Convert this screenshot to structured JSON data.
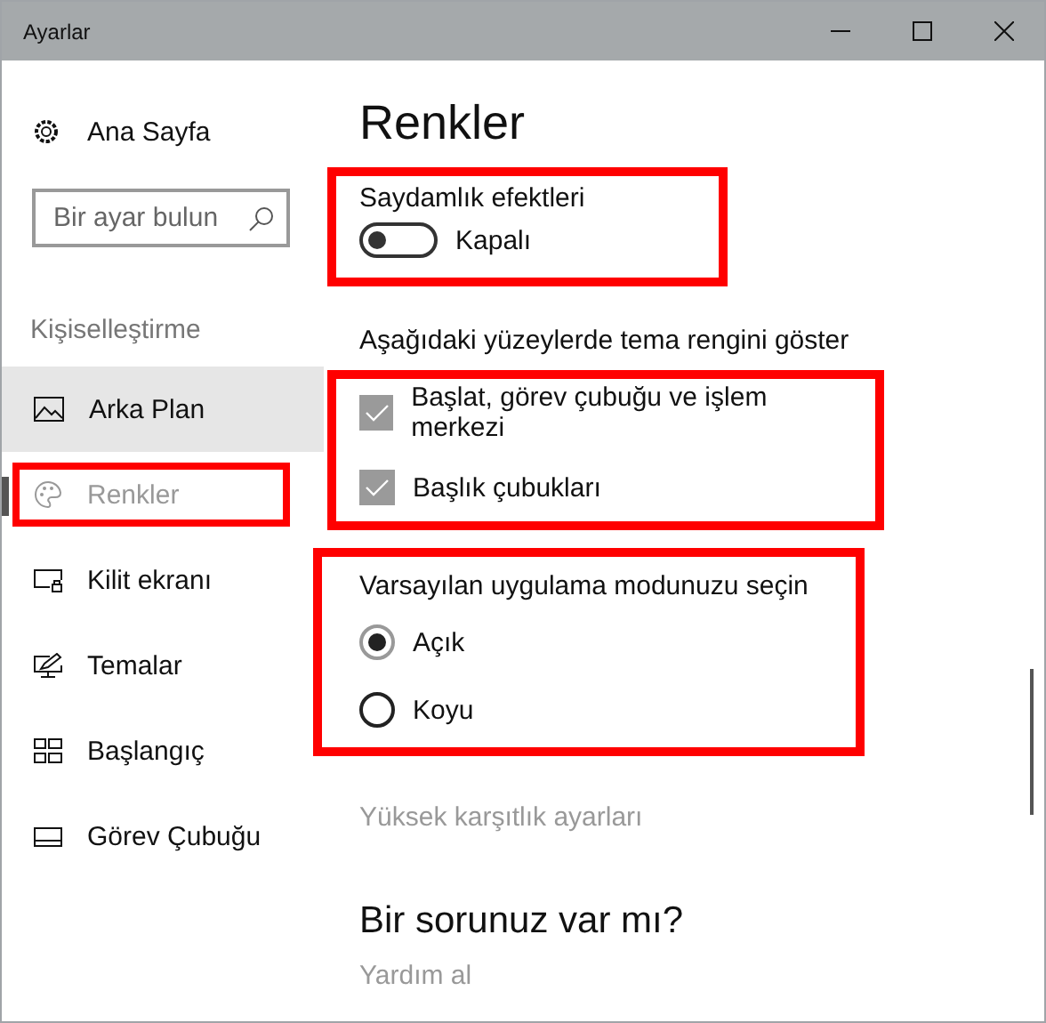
{
  "window": {
    "title": "Ayarlar"
  },
  "sidebar": {
    "home": "Ana Sayfa",
    "search": {
      "placeholder": "Bir ayar bulun"
    },
    "section": "Kişiselleştirme",
    "items": [
      {
        "label": "Arka Plan",
        "selected": false,
        "hovered": true,
        "highlighted": false
      },
      {
        "label": "Renkler",
        "selected": true,
        "hovered": false,
        "highlighted": true
      },
      {
        "label": "Kilit ekranı",
        "selected": false,
        "hovered": false,
        "highlighted": false
      },
      {
        "label": "Temalar",
        "selected": false,
        "hovered": false,
        "highlighted": false
      },
      {
        "label": "Başlangıç",
        "selected": false,
        "hovered": false,
        "highlighted": false
      },
      {
        "label": "Görev Çubuğu",
        "selected": false,
        "hovered": false,
        "highlighted": false
      }
    ]
  },
  "page": {
    "title": "Renkler",
    "transparency": {
      "label": "Saydamlık efektleri",
      "on": false,
      "state": "Kapalı",
      "highlighted": true
    },
    "accent_surfaces": {
      "label": "Aşağıdaki yüzeylerde tema rengini göster",
      "highlighted": true,
      "options": [
        {
          "label": "Başlat, görev çubuğu ve işlem merkezi",
          "checked": true
        },
        {
          "label": "Başlık çubukları",
          "checked": true
        }
      ]
    },
    "app_mode": {
      "label": "Varsayılan uygulama modunuzu seçin",
      "highlighted": true,
      "options": [
        {
          "label": "Açık",
          "selected": true
        },
        {
          "label": "Koyu",
          "selected": false
        }
      ]
    },
    "high_contrast_link": "Yüksek karşıtlık ayarları",
    "help": {
      "title": "Bir sorunuz var mı?",
      "link": "Yardım al"
    }
  }
}
